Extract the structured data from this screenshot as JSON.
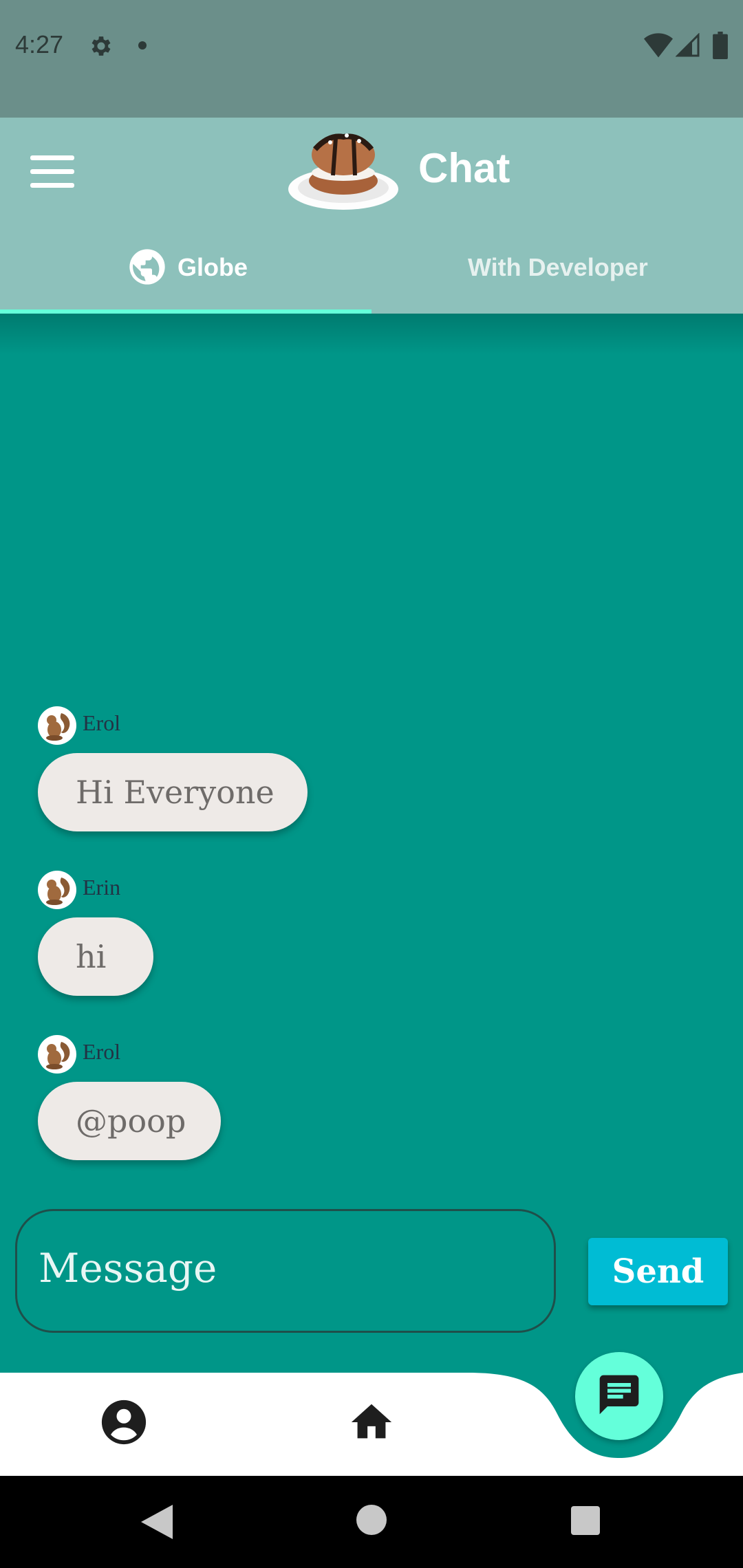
{
  "status_bar": {
    "time": "4:27"
  },
  "app_bar": {
    "title": "Chat"
  },
  "tabs": [
    {
      "label": "Globe",
      "selected": true
    },
    {
      "label": "With Developer",
      "selected": false
    }
  ],
  "messages": [
    {
      "username": "Erol",
      "text": "Hi Everyone"
    },
    {
      "username": "Erin",
      "text": "hi"
    },
    {
      "username": "Erol",
      "text": "@poop"
    }
  ],
  "composer": {
    "placeholder": "Message",
    "send_label": "Send"
  },
  "colors": {
    "background": "#009688",
    "app_bar": "#8dc1bb",
    "accent": "#64ffda",
    "send_button": "#00bcd4",
    "bubble": "#eeeae7"
  },
  "icons": {
    "menu": "menu-icon",
    "globe": "globe-icon",
    "profile": "account-circle-icon",
    "home": "home-icon",
    "chat": "chat-icon"
  }
}
